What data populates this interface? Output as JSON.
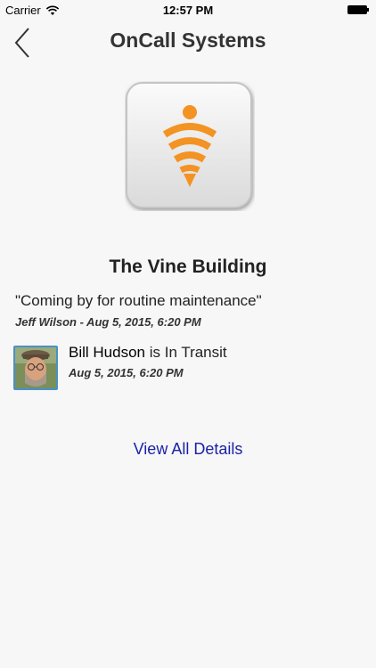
{
  "status_bar": {
    "carrier": "Carrier",
    "time": "12:57 PM"
  },
  "nav": {
    "title": "OnCall Systems",
    "back_icon": "chevron-left-icon"
  },
  "logo": {
    "icon": "signal-beacon-icon",
    "accent_color": "#f39323"
  },
  "location": {
    "name": "The Vine Building"
  },
  "message": {
    "text": "\"Coming by for routine maintenance\"",
    "meta": "Jeff Wilson - Aug 5, 2015, 6:20 PM"
  },
  "technician": {
    "name": "Bill Hudson",
    "status_suffix": " is In Transit",
    "timestamp": "Aug 5, 2015, 6:20 PM"
  },
  "actions": {
    "view_all": "View All Details",
    "link_color": "#1a22a8"
  }
}
